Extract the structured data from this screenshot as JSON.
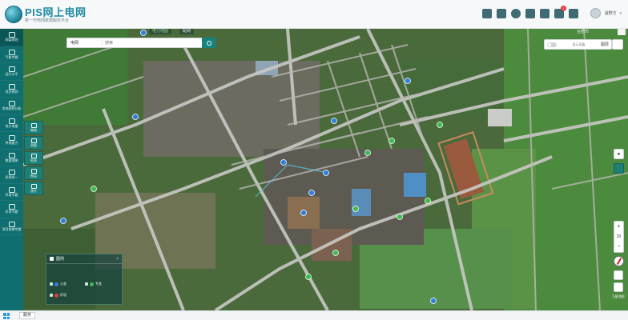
{
  "header": {
    "title": "PIS网上电网",
    "subtitle": "新一代电网数据服务平台",
    "user_name": "温野方",
    "notification_count": "1",
    "icons": [
      "layers-icon",
      "chat-icon",
      "compass-icon",
      "volume-icon",
      "pin-icon",
      "document-icon",
      "bell-icon",
      "avatar-icon"
    ]
  },
  "sidebar": {
    "items": [
      {
        "label": "网架规划",
        "icon": "grid-icon"
      },
      {
        "label": "气象专题",
        "icon": "cloud-icon"
      },
      {
        "label": "运行水平",
        "icon": "monitor-icon"
      },
      {
        "label": "项目规划",
        "icon": "list-icon"
      },
      {
        "label": "用电结构分析",
        "icon": "chart-icon"
      },
      {
        "label": "电力电量",
        "icon": "bolt-icon"
      },
      {
        "label": "供电能力",
        "icon": "plug-icon"
      },
      {
        "label": "数据地图",
        "icon": "globe-icon"
      },
      {
        "label": "多规合一",
        "icon": "merge-icon"
      },
      {
        "label": "环境专题",
        "icon": "leaf-icon"
      },
      {
        "label": "负荷专题",
        "icon": "load-icon"
      },
      {
        "label": "项目前期专题",
        "icon": "file-icon"
      }
    ]
  },
  "map": {
    "tabs": [
      "电力地图",
      "配网"
    ],
    "search": {
      "select": "电网",
      "placeholder": "搜索",
      "clear": "×"
    },
    "location": "合肥市",
    "toggle_label": "显示设备",
    "layer_label": "图层",
    "left_tools": [
      "缩放",
      "测量",
      "框选",
      "图层",
      "统计"
    ],
    "legend": {
      "title": "图例",
      "items": [
        {
          "label": "公变",
          "color": "#2f7fe0"
        },
        {
          "label": "专变",
          "color": "#3dbb4f"
        },
        {
          "label": "杆塔",
          "color": "#e23b3b"
        }
      ]
    },
    "zoom_level": "20",
    "map_switch_label": "卫星地图",
    "colors": {
      "accent": "#16837f",
      "substation": "#2f7fe0",
      "pole": "#3dbb4f"
    }
  },
  "taskbar": {
    "item": "服务"
  }
}
